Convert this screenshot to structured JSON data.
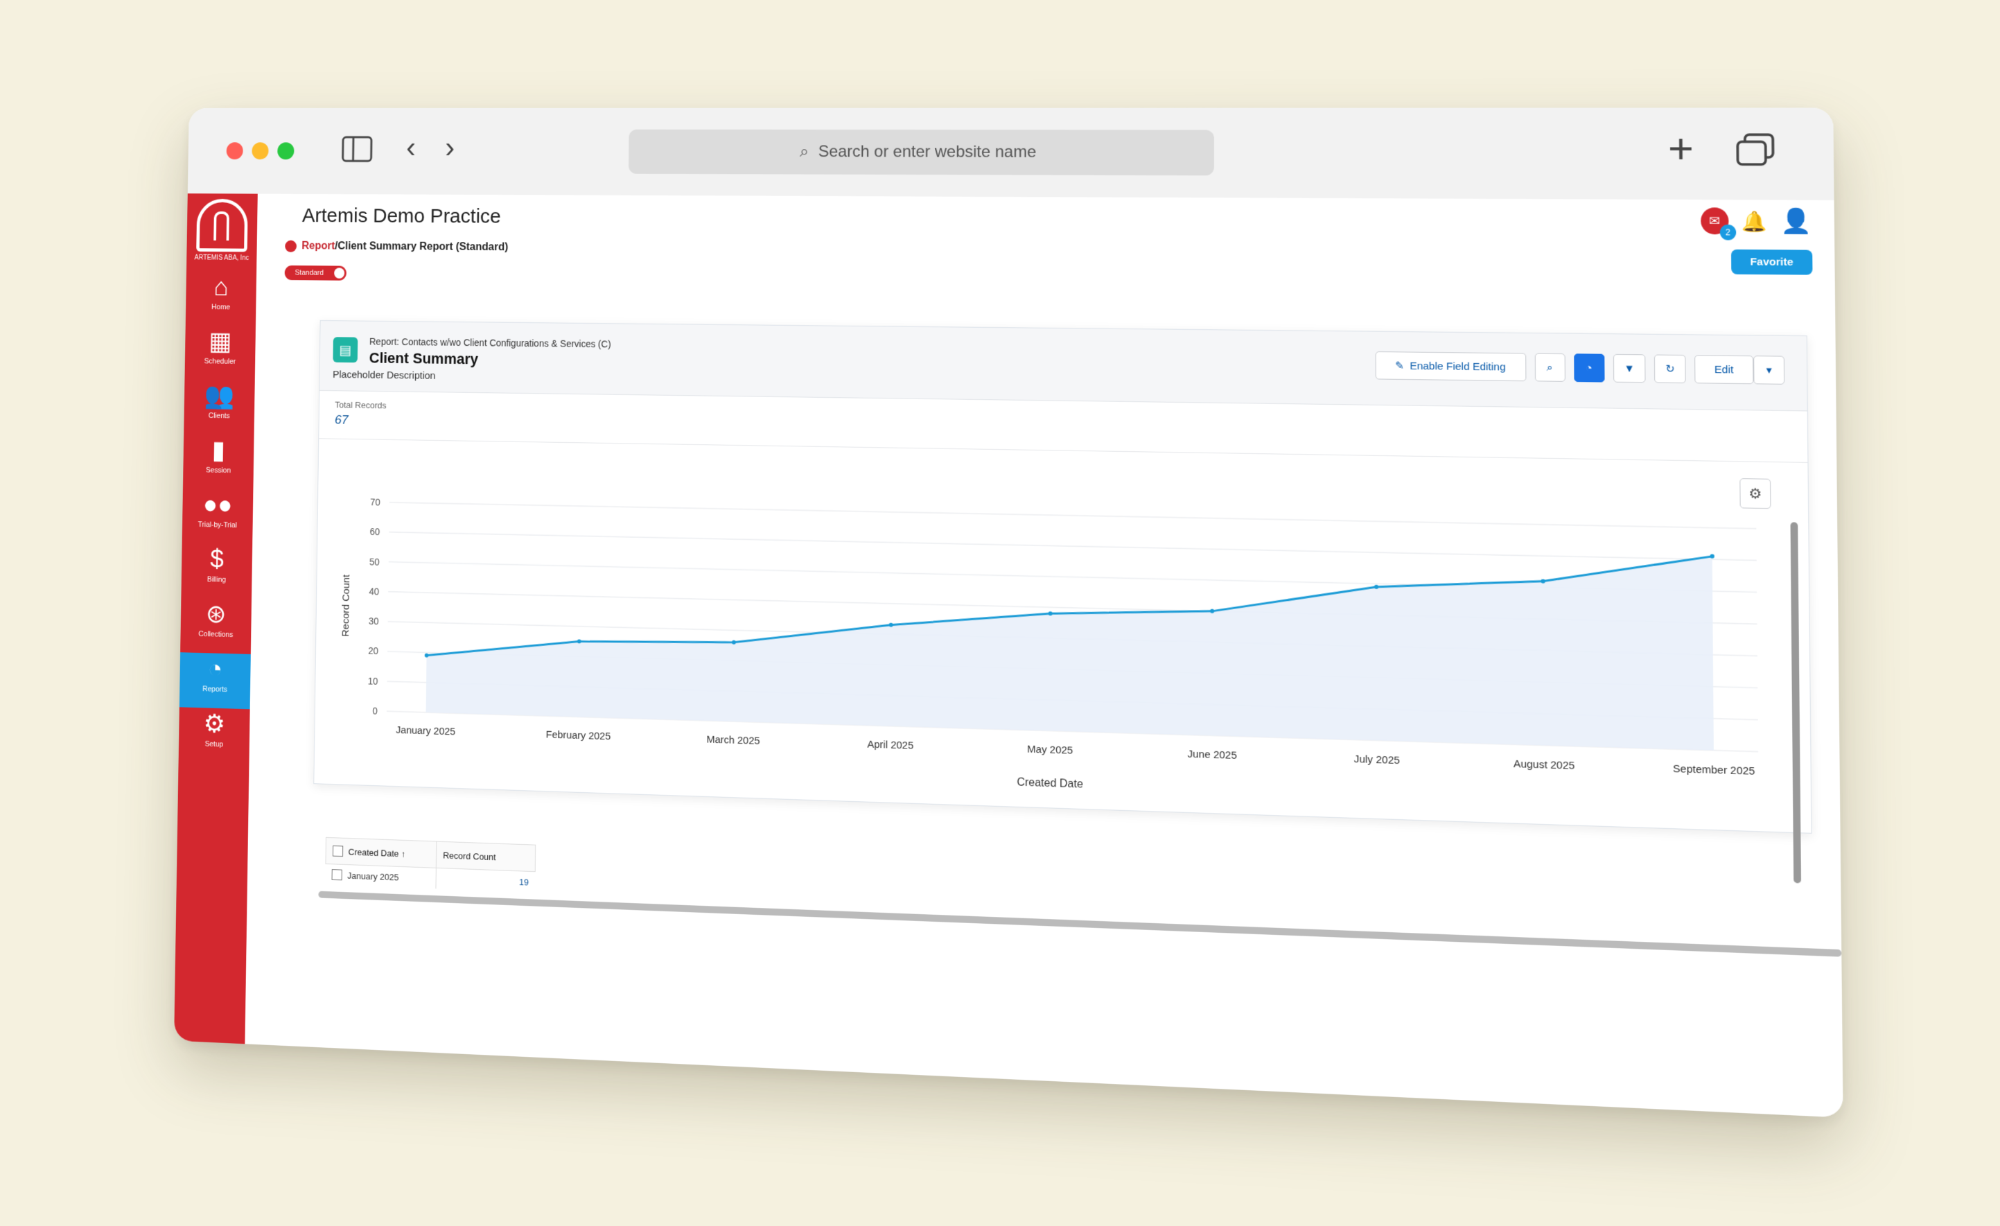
{
  "browser": {
    "url_placeholder": "Search or enter website name",
    "traffic_colors": [
      "#ff5f57",
      "#febc2e",
      "#28c840"
    ]
  },
  "sidebar": {
    "org": "ARTEMIS ABA, Inc",
    "items": [
      {
        "label": "Home",
        "icon": "home-icon"
      },
      {
        "label": "Scheduler",
        "icon": "calendar-icon"
      },
      {
        "label": "Clients",
        "icon": "people-icon"
      },
      {
        "label": "Session",
        "icon": "session-icon"
      },
      {
        "label": "Trial-by-Trial",
        "icon": "footprints-icon"
      },
      {
        "label": "Billing",
        "icon": "dollar-icon"
      },
      {
        "label": "Collections",
        "icon": "coin-icon"
      },
      {
        "label": "Reports",
        "icon": "pie-icon"
      },
      {
        "label": "Setup",
        "icon": "gear-icon"
      }
    ],
    "active_index": 7
  },
  "header": {
    "title": "Artemis Demo Practice",
    "crumb_root": "Report",
    "crumb_rest": "/Client Summary Report (Standard)",
    "toggle_label": "Standard",
    "chat_count": "2",
    "favorite": "Favorite"
  },
  "report": {
    "type_line": "Report: Contacts w/wo Client Configurations & Services (C)",
    "title": "Client Summary",
    "description": "Placeholder Description",
    "enable_editing": "Enable Field Editing",
    "edit": "Edit",
    "total_label": "Total Records",
    "total_value": "67"
  },
  "chart_data": {
    "type": "area",
    "categories": [
      "January 2025",
      "February 2025",
      "March 2025",
      "April 2025",
      "May 2025",
      "June 2025",
      "July 2025",
      "August 2025",
      "September 2025"
    ],
    "series": [
      {
        "values": [
          19,
          25,
          26,
          33,
          38,
          40,
          49,
          52,
          61
        ]
      }
    ],
    "xlabel": "Created Date",
    "ylabel": "Record Count",
    "ylim": [
      0,
      70
    ],
    "yticks": [
      0,
      10,
      20,
      30,
      40,
      50,
      60,
      70
    ],
    "grid": true,
    "color": "#1a9bd6"
  },
  "table": {
    "col1": "Created Date",
    "col1_sort": "↑",
    "col2": "Record Count",
    "rows": [
      {
        "date": "January 2025",
        "count": "19"
      }
    ]
  }
}
